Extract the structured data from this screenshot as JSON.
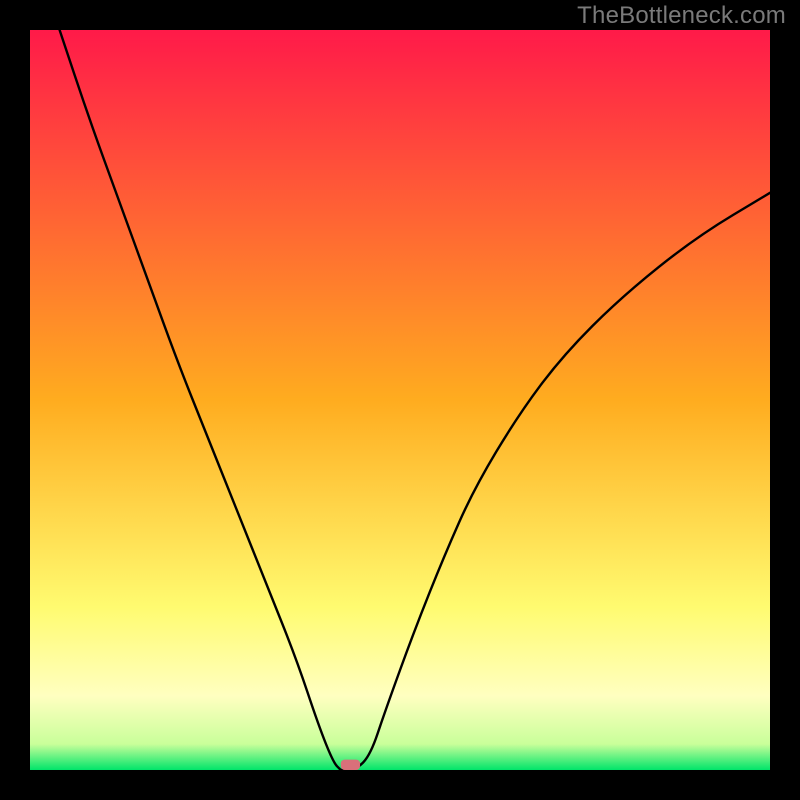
{
  "watermark": "TheBottleneck.com",
  "chart_data": {
    "type": "line",
    "title": "",
    "xlabel": "",
    "ylabel": "",
    "xlim": [
      0,
      100
    ],
    "ylim": [
      0,
      100
    ],
    "background_gradient": {
      "stops": [
        {
          "offset": 0.0,
          "color": "#ff1a49"
        },
        {
          "offset": 0.5,
          "color": "#ffac1f"
        },
        {
          "offset": 0.78,
          "color": "#fffb70"
        },
        {
          "offset": 0.9,
          "color": "#ffffc0"
        },
        {
          "offset": 0.965,
          "color": "#c9ff9a"
        },
        {
          "offset": 1.0,
          "color": "#00e56a"
        }
      ]
    },
    "curve": {
      "minimum_x": 42,
      "left_branch": [
        {
          "x": 4,
          "y": 100
        },
        {
          "x": 8,
          "y": 88
        },
        {
          "x": 12,
          "y": 77
        },
        {
          "x": 16,
          "y": 66
        },
        {
          "x": 20,
          "y": 55
        },
        {
          "x": 24,
          "y": 45
        },
        {
          "x": 28,
          "y": 35
        },
        {
          "x": 32,
          "y": 25
        },
        {
          "x": 36,
          "y": 15
        },
        {
          "x": 39,
          "y": 6
        },
        {
          "x": 41,
          "y": 1
        },
        {
          "x": 42,
          "y": 0
        }
      ],
      "right_branch": [
        {
          "x": 42,
          "y": 0
        },
        {
          "x": 44,
          "y": 0
        },
        {
          "x": 46,
          "y": 2
        },
        {
          "x": 48,
          "y": 8
        },
        {
          "x": 52,
          "y": 19
        },
        {
          "x": 56,
          "y": 29
        },
        {
          "x": 60,
          "y": 38
        },
        {
          "x": 66,
          "y": 48
        },
        {
          "x": 72,
          "y": 56
        },
        {
          "x": 80,
          "y": 64
        },
        {
          "x": 90,
          "y": 72
        },
        {
          "x": 100,
          "y": 78
        }
      ]
    },
    "marker": {
      "x": 43.3,
      "y": 0,
      "color": "#d9707a",
      "width": 2.6,
      "height": 1.4
    }
  }
}
